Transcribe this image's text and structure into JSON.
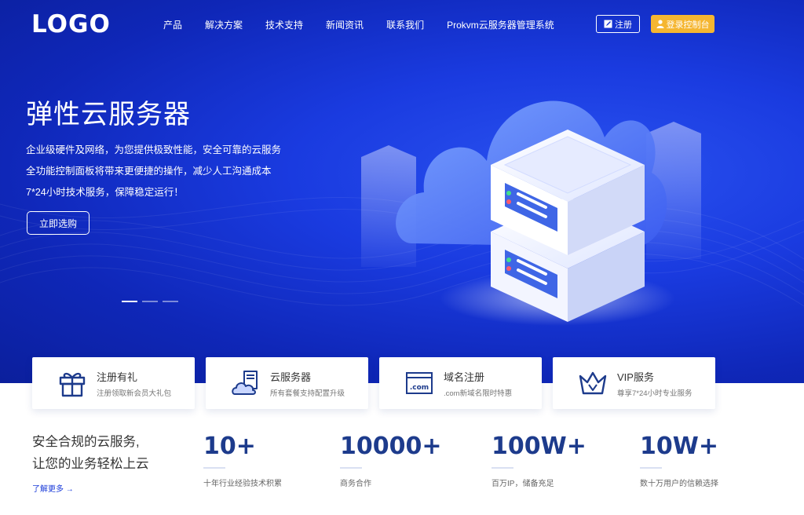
{
  "header": {
    "logo": "LOGO",
    "nav": [
      "产品",
      "解决方案",
      "技术支持",
      "新闻资讯",
      "联系我们",
      "Prokvm云服务器管理系统"
    ],
    "register_label": "注册",
    "console_label": "登录控制台"
  },
  "hero": {
    "title": "弹性云服务器",
    "lines": [
      "企业级硬件及网络，为您提供极致性能，安全可靠的云服务",
      "全功能控制面板将带来更便捷的操作，减少人工沟通成本",
      "7*24小时技术服务，保障稳定运行！"
    ],
    "button": "立即选购",
    "slides": 3,
    "active_slide": 1
  },
  "cards": [
    {
      "title": "注册有礼",
      "sub": "注册领取新会员大礼包",
      "icon": "gift-icon"
    },
    {
      "title": "云服务器",
      "sub": "所有套餐支持配置升级",
      "icon": "cloud-server-icon"
    },
    {
      "title": "域名注册",
      "sub": ".com新域名限时特惠",
      "icon": "dot-com-icon",
      "icon_text": ".com"
    },
    {
      "title": "VIP服务",
      "sub": "尊享7*24小时专业服务",
      "icon": "crown-icon"
    }
  ],
  "intro": {
    "line1": "安全合规的云服务,",
    "line2": "让您的业务轻松上云",
    "more": "了解更多 →"
  },
  "stats": [
    {
      "value": "10+",
      "desc": "十年行业经验技术积累"
    },
    {
      "value": "10000+",
      "desc": "商务合作"
    },
    {
      "value": "100W+",
      "desc": "百万IP，储备充足"
    },
    {
      "value": "10W+",
      "desc": "数十万用户的信赖选择"
    }
  ],
  "colors": {
    "hero_bg": "#1533d0",
    "accent_button": "#f5b631",
    "stat_number": "#1d3b8c",
    "link": "#1a3bd9"
  }
}
